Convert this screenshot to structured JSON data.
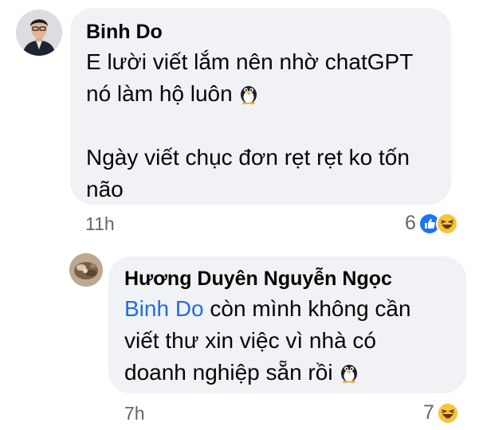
{
  "comments": [
    {
      "author": "Binh Do",
      "lines": [
        "E lười viết lắm nên nhờ chatGPT",
        "nó làm hộ luôn",
        "",
        "Ngày viết chục đơn rẹt rẹt ko tốn",
        "não"
      ],
      "time": "11h",
      "reaction_count": "6",
      "reaction_icons": [
        "like-icon",
        "haha-icon"
      ]
    },
    {
      "author": "Hương Duyên Nguyễn Ngọc",
      "mention": "Binh Do",
      "lines": [
        "còn mình không cần",
        "viết thư xin việc vì nhà có",
        "doanh nghiệp sẵn rồi"
      ],
      "time": "7h",
      "reaction_count": "7",
      "reaction_icons": [
        "haha-icon"
      ]
    }
  ],
  "colors": {
    "bubble": "#f0f2f5",
    "meta_text": "#65676b",
    "mention": "#216fdb",
    "like": "#1877f2",
    "haha": "#f7c33b"
  }
}
